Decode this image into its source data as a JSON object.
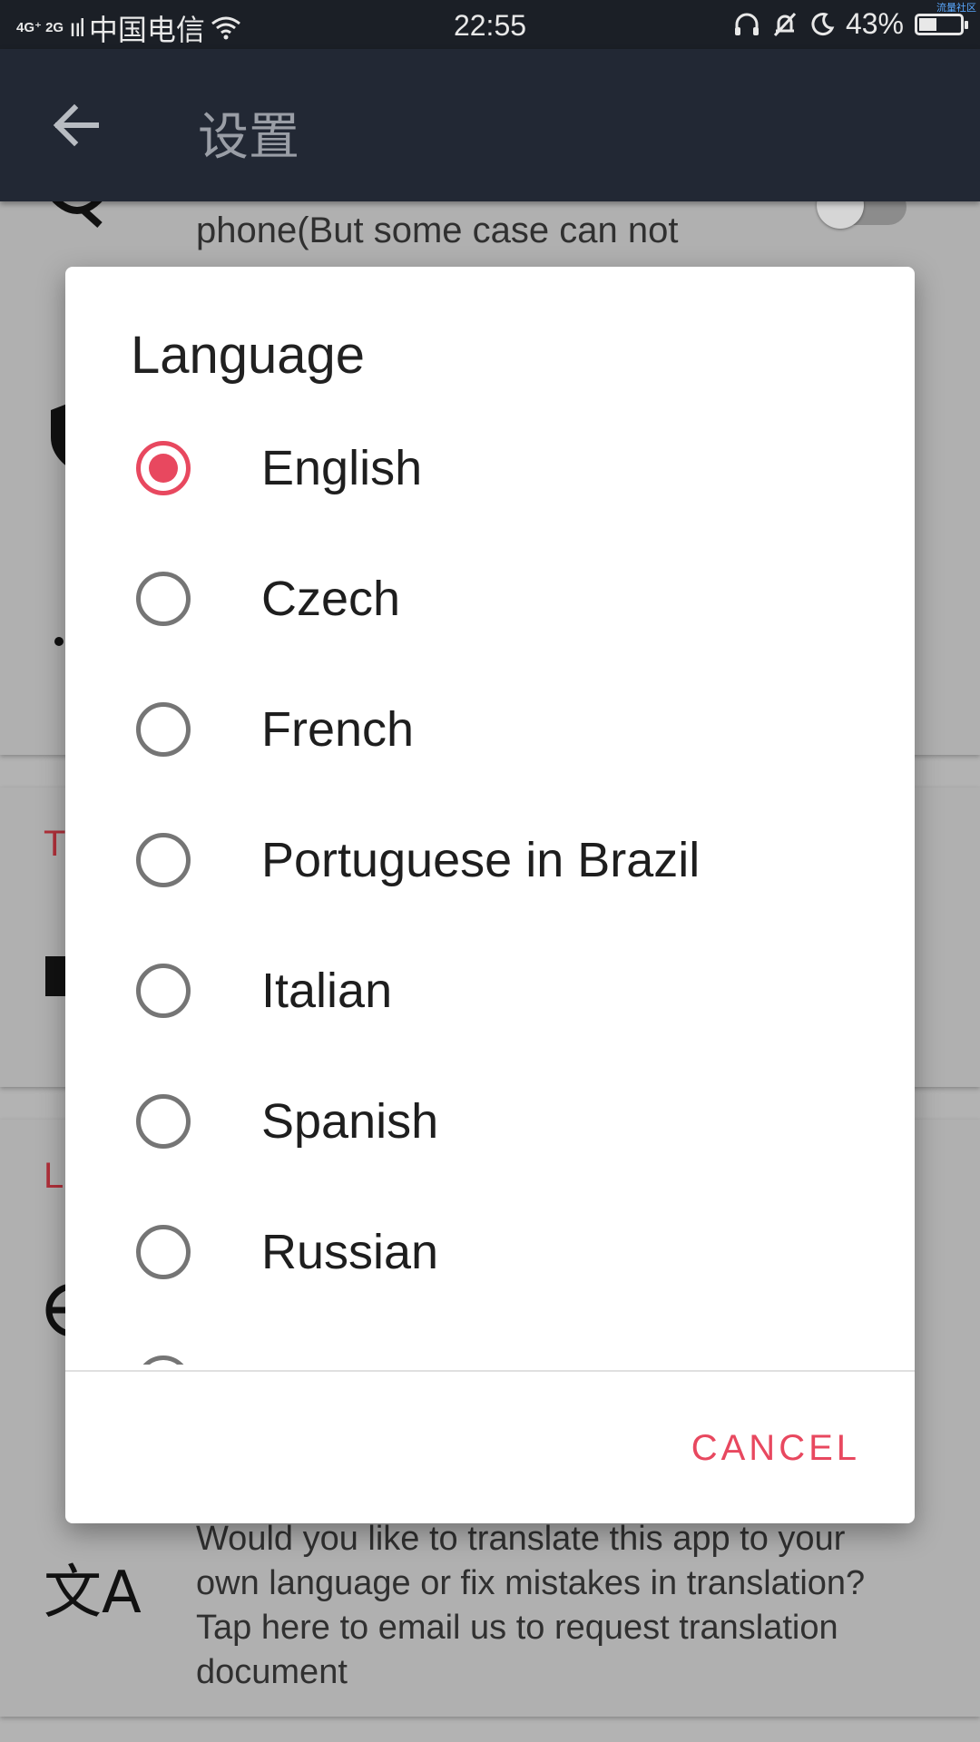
{
  "status_bar": {
    "network": "4G⁺ 2G",
    "signal": "ııl",
    "carrier": "中国电信",
    "time": "22:55",
    "battery": "43%",
    "battery_level": 0.43,
    "watermark": "流量社区"
  },
  "toolbar": {
    "back_icon": "arrow-left-icon",
    "title": "设置"
  },
  "background": {
    "card1_text": "phone(But some case can not",
    "section_letter_1": "T",
    "section_letter_2": "L",
    "translate_text": [
      "Would you like to translate this app to your",
      "own language or fix mistakes in translation?",
      "Tap here to email us to request translation",
      "document"
    ]
  },
  "dialog": {
    "title": "Language",
    "selected_index": 0,
    "options": [
      {
        "label": "English",
        "checked": true
      },
      {
        "label": "Czech",
        "checked": false
      },
      {
        "label": "French",
        "checked": false
      },
      {
        "label": "Portuguese in Brazil",
        "checked": false
      },
      {
        "label": "Italian",
        "checked": false
      },
      {
        "label": "Spanish",
        "checked": false
      },
      {
        "label": "Russian",
        "checked": false
      },
      {
        "label": "",
        "checked": false
      }
    ],
    "cancel_label": "CANCEL"
  },
  "colors": {
    "accent": "#e8485f",
    "toolbar": "#222834",
    "statusbar": "#1b1f26"
  }
}
